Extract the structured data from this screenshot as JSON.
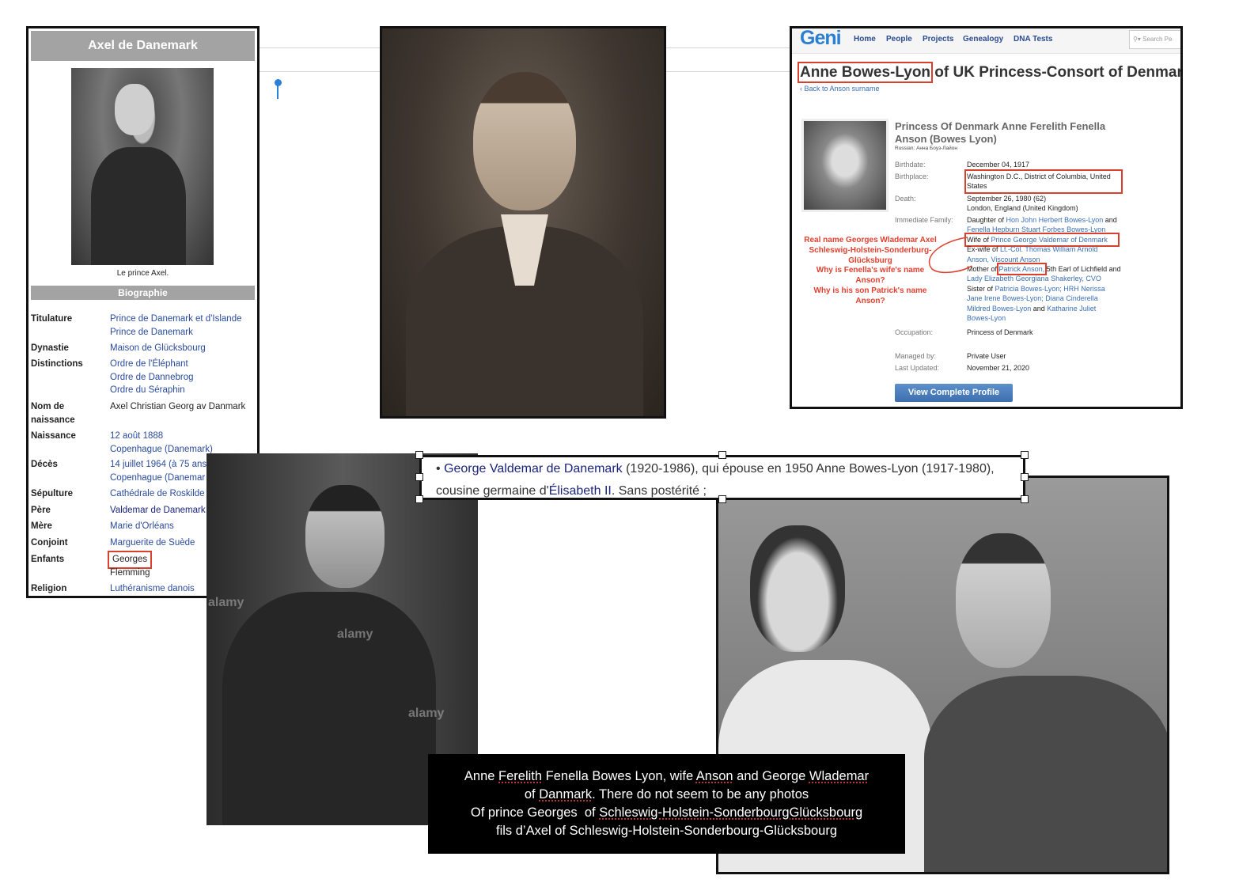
{
  "wiki": {
    "title": "Axel de Danemark",
    "photo_caption": "Le prince Axel.",
    "section": "Biographie",
    "rows": [
      {
        "label": "Titulature",
        "values": [
          "Prince de Danemark et d'Islande",
          "Prince de Danemark"
        ]
      },
      {
        "label": "Dynastie",
        "values": [
          "Maison de Glücksbourg"
        ]
      },
      {
        "label": "Distinctions",
        "values": [
          "Ordre de l'Éléphant",
          "Ordre de Dannebrog",
          "Ordre du Séraphin"
        ]
      },
      {
        "label": "Nom de naissance",
        "values": [
          "Axel Christian Georg av Danmark"
        ]
      },
      {
        "label": "Naissance",
        "values": [
          "12 août 1888",
          "Copenhague (Danemark)"
        ]
      },
      {
        "label": "Décès",
        "values": [
          "14 juillet 1964 (à 75 ans",
          "Copenhague (Danemar"
        ]
      },
      {
        "label": "Sépulture",
        "values": [
          "Cathédrale de Roskilde"
        ]
      },
      {
        "label": "Père",
        "values": [
          "Valdemar de Danemark"
        ]
      },
      {
        "label": "Mère",
        "values": [
          "Marie d'Orléans"
        ]
      },
      {
        "label": "Conjoint",
        "values": [
          "Marguerite de Suède"
        ]
      },
      {
        "label": "Enfants",
        "values": [
          "Georges",
          "Flemming"
        ]
      },
      {
        "label": "Religion",
        "values": [
          "Luthéranisme danois"
        ]
      }
    ]
  },
  "geni": {
    "logo": "Geni",
    "nav": [
      "Home",
      "People",
      "Projects",
      "Genealogy",
      "DNA Tests"
    ],
    "search_placeholder": "Search Pe",
    "title_boxed": "Anne Bowes-Lyon",
    "title_rest": " of UK Princess-Consort of Denmark",
    "back_link": "‹ Back to Anson surname",
    "full_name": "Princess Of Denmark Anne Ferelith Fenella Anson (Bowes Lyon)",
    "russian": "Russian: Анна Боуз-Лайон",
    "birthdate_label": "Birthdate:",
    "birthdate": "December 04, 1917",
    "birthplace_label": "Birthplace:",
    "birthplace": "Washington D.C., District of Columbia, United States",
    "death_label": "Death:",
    "death": "September 26, 1980 (62)",
    "death_place": "London, England (United Kingdom)",
    "family_label": "Immediate Family:",
    "family": {
      "daughter_of": "Daughter of",
      "father": "Hon John Herbert Bowes-Lyon",
      "and": "and",
      "mother": "Fenella Hepburn Stuart Forbes Bowes-Lyon",
      "wife_of": "Wife of",
      "husband": "Prince George Valdemar of Denmark",
      "exwife_of": "Ex-wife of",
      "exhusband": "Lt.-Col. Thomas William Arnold Anson, Viscount Anson",
      "mother_of": "Mother of",
      "son": "Patrick Anson,",
      "son_rest": "5th Earl of Lichfield",
      "and2": "and",
      "daughter": "Lady Elizabeth Georgiana Shakerley, CVO",
      "sister_of": "Sister of",
      "siblings": "Patricia Bowes-Lyon; HRH Nerissa Jane Irene Bowes-Lyon; Diana Cinderella Mildred Bowes-Lyon",
      "and3": "and",
      "sibling_last": "Katharine Juliet Bowes-Lyon"
    },
    "occupation_label": "Occupation:",
    "occupation": "Princess of Denmark",
    "managed_label": "Managed by:",
    "managed": "Private User",
    "updated_label": "Last Updated:",
    "updated": "November 21, 2020",
    "button": "View Complete Profile",
    "annotation": [
      "Real name Georges Wlademar Axel",
      "Schleswig-Holstein-Sonderburg-",
      "Glücksburg",
      "Why is Fenella's wife's name",
      "Anson?",
      "Why is his son Patrick's name",
      "Anson?"
    ]
  },
  "textbox": {
    "link1": "George Valdemar de Danemark",
    "text1": " (1920-1986), qui épouse en 1950 Anne Bowes-Lyon (1917-1980), cousine germaine d'",
    "link2": "Élisabeth II",
    "text2": ". Sans postérité ;"
  },
  "caption": {
    "l1a": "Anne ",
    "l1b": "Ferelith",
    "l1c": " Fenella Bowes Lyon, wife ",
    "l1d": "Anson",
    "l1e": " and George ",
    "l1f": "Wlademar",
    "l2a": "of ",
    "l2b": "Danmark",
    "l2c": ". There do not seem to be any photos",
    "l3a": "Of prince Georges  of ",
    "l3b": "Schleswig-Holstein-SonderbourgGlücksbourg",
    "l4": "fils d’Axel of Schleswig-Holstein-Sonderbourg-Glücksbourg"
  },
  "watermark": "alamy",
  "colors": {
    "annotation_red": "#e0402f",
    "link_blue": "#2a4b9b",
    "geni_blue": "#2b7fd0"
  }
}
